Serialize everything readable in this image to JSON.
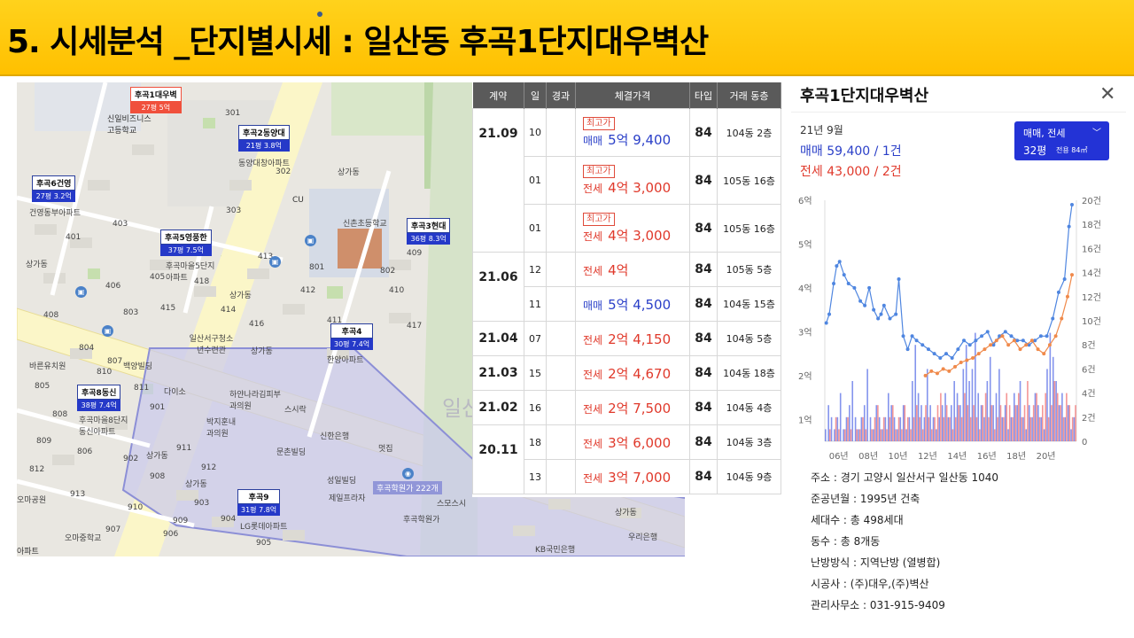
{
  "slide": {
    "title": "5. 시세분석 _단지별시세 : 일산동 후곡1단지대우벽산"
  },
  "map": {
    "watermark": "일산",
    "pins": [
      {
        "name": "후곡1대우벽",
        "price": "27평 5억",
        "color": "red"
      },
      {
        "name": "후곡2동양대",
        "price": "21평 3.8억",
        "color": "blue"
      },
      {
        "name": "후곡6건영",
        "price": "27평 3.2억",
        "color": "blue"
      },
      {
        "name": "후곡5영풍한",
        "price": "37평 7.5억",
        "color": "blue"
      },
      {
        "name": "후곡3현대",
        "price": "36평 8.3억",
        "color": "blue"
      },
      {
        "name": "후곡4",
        "price": "30평 7.4억",
        "color": "blue"
      },
      {
        "name": "후곡8동신",
        "price": "38평 7.4억",
        "color": "blue"
      },
      {
        "name": "후곡9",
        "price": "31평 7.8억",
        "color": "blue"
      }
    ],
    "labels": [
      "신일비즈니스고등학교",
      "동양대창아파트",
      "건영동부아파트",
      "상가동",
      "CU",
      "신촌초등학교",
      "후곡마을5단지아파트",
      "상가동",
      "일산서구청소년수련관",
      "상가동",
      "한양아파트",
      "바른유치원",
      "백양빌딩",
      "다이소",
      "하얀나라김피부과의원",
      "스시락",
      "후곡마을8단지동신아파트",
      "박지훈내과의원",
      "신한은행",
      "문촌빌딩",
      "멋집",
      "상가동",
      "상가동",
      "성일빌딩",
      "제일프라자",
      "후곡학원가",
      "스모스시",
      "LG롯데아파트",
      "오마중학교",
      "오마공원",
      "상가동",
      "우리은행",
      "KB국민은행",
      "상가동",
      "아파트"
    ],
    "busy_tag": "후곡학원가 222개",
    "numbers": [
      "401",
      "403",
      "405",
      "406",
      "408",
      "409",
      "410",
      "411",
      "412",
      "413",
      "414",
      "415",
      "416",
      "417",
      "418",
      "801",
      "802",
      "803",
      "804",
      "805",
      "806",
      "807",
      "808",
      "809",
      "810",
      "811",
      "812",
      "901",
      "902",
      "903",
      "904",
      "905",
      "906",
      "907",
      "908",
      "909",
      "910",
      "911",
      "912",
      "913",
      "301",
      "302",
      "303"
    ]
  },
  "trades": {
    "headers": [
      "계약",
      "일",
      "경과",
      "체결가격",
      "타입",
      "거래 동층"
    ],
    "groups": [
      {
        "ym": "21.09",
        "rows": [
          {
            "day": "10",
            "tag": "최고가",
            "kind": "매매",
            "amt": "5억 9,400",
            "type": "84",
            "dong": "104동  2층",
            "color": "sale"
          },
          {
            "day": "01",
            "tag": "최고가",
            "kind": "전세",
            "amt": "4억 3,000",
            "type": "84",
            "dong": "105동 16층",
            "color": "jeon"
          },
          {
            "day": "01",
            "tag": "최고가",
            "kind": "전세",
            "amt": "4억 3,000",
            "type": "84",
            "dong": "105동 16층",
            "color": "jeon"
          }
        ]
      },
      {
        "ym": "21.06",
        "rows": [
          {
            "day": "12",
            "tag": "",
            "kind": "전세",
            "amt": "4억",
            "type": "84",
            "dong": "105동  5층",
            "color": "jeon"
          },
          {
            "day": "11",
            "tag": "",
            "kind": "매매",
            "amt": "5억 4,500",
            "type": "84",
            "dong": "104동 15층",
            "color": "sale"
          }
        ]
      },
      {
        "ym": "21.04",
        "rows": [
          {
            "day": "07",
            "tag": "",
            "kind": "전세",
            "amt": "2억 4,150",
            "type": "84",
            "dong": "104동  5층",
            "color": "jeon"
          }
        ]
      },
      {
        "ym": "21.03",
        "rows": [
          {
            "day": "15",
            "tag": "",
            "kind": "전세",
            "amt": "2억 4,670",
            "type": "84",
            "dong": "104동 18층",
            "color": "jeon"
          }
        ]
      },
      {
        "ym": "21.02",
        "rows": [
          {
            "day": "16",
            "tag": "",
            "kind": "전세",
            "amt": "2억 7,500",
            "type": "84",
            "dong": "104동  4층",
            "color": "jeon"
          }
        ]
      },
      {
        "ym": "20.11",
        "rows": [
          {
            "day": "18",
            "tag": "",
            "kind": "전세",
            "amt": "3억 6,000",
            "type": "84",
            "dong": "104동  3층",
            "color": "jeon"
          },
          {
            "day": "13",
            "tag": "",
            "kind": "전세",
            "amt": "3억 7,000",
            "type": "84",
            "dong": "104동  9층",
            "color": "jeon"
          }
        ]
      }
    ]
  },
  "panel": {
    "title": "후곡1단지대우벽산",
    "month": "21년 9월",
    "sale_summary": "매매 59,400 / 1건",
    "jeonse_summary": "전세 43,000 / 2건",
    "selector_label": "매매, 전세",
    "selector_size": "32평",
    "selector_sub": "전용 84㎡",
    "colors": {
      "sale": "#2a3fc8",
      "jeonse": "#e0392b",
      "sale_line": "#4f86e0",
      "jeonse_line": "#f08a4b"
    }
  },
  "chart_data": {
    "type": "line",
    "x_ticks": [
      "06년",
      "08년",
      "10년",
      "12년",
      "14년",
      "16년",
      "18년",
      "20년"
    ],
    "y_left_ticks": [
      "1억",
      "2억",
      "3억",
      "4억",
      "5억",
      "6억"
    ],
    "y_left_range": [
      0.5,
      6
    ],
    "y_right_ticks": [
      "0",
      "2건",
      "4건",
      "6건",
      "8건",
      "10건",
      "12건",
      "14건",
      "16건",
      "18건",
      "20건"
    ],
    "y_right_range": [
      0,
      20
    ],
    "series": [
      {
        "name": "매매",
        "unit": "억",
        "x": [
          2005.1,
          2005.3,
          2005.6,
          2005.8,
          2006.0,
          2006.3,
          2006.6,
          2007.0,
          2007.4,
          2007.7,
          2008.0,
          2008.3,
          2008.6,
          2008.8,
          2009.0,
          2009.4,
          2009.8,
          2010.0,
          2010.3,
          2010.6,
          2010.9,
          2011.2,
          2011.6,
          2012.0,
          2012.4,
          2012.8,
          2013.2,
          2013.6,
          2014.0,
          2014.4,
          2014.8,
          2015.2,
          2015.6,
          2016.0,
          2016.4,
          2016.8,
          2017.2,
          2017.6,
          2018.0,
          2018.4,
          2018.8,
          2019.2,
          2019.6,
          2020.0,
          2020.4,
          2020.8,
          2021.2,
          2021.5,
          2021.7
        ],
        "values": [
          3.2,
          3.4,
          4.1,
          4.5,
          4.6,
          4.3,
          4.1,
          4.0,
          3.7,
          3.6,
          4.0,
          3.5,
          3.3,
          3.4,
          3.6,
          3.3,
          3.4,
          4.2,
          2.9,
          2.6,
          2.9,
          2.8,
          2.7,
          2.6,
          2.5,
          2.4,
          2.5,
          2.4,
          2.6,
          2.8,
          2.7,
          2.8,
          2.9,
          3.0,
          2.7,
          2.9,
          3.0,
          2.9,
          2.8,
          2.8,
          2.7,
          2.8,
          2.9,
          2.9,
          3.3,
          3.9,
          4.2,
          5.4,
          5.9
        ]
      },
      {
        "name": "전세",
        "unit": "억",
        "x": [
          2011.8,
          2012.2,
          2012.6,
          2013.0,
          2013.4,
          2013.8,
          2014.2,
          2014.6,
          2015.0,
          2015.4,
          2015.8,
          2016.2,
          2016.6,
          2017.0,
          2017.4,
          2017.8,
          2018.2,
          2018.6,
          2019.0,
          2019.4,
          2019.8,
          2020.2,
          2020.6,
          2021.0,
          2021.4,
          2021.7
        ],
        "values": [
          2.0,
          2.1,
          2.05,
          2.15,
          2.1,
          2.2,
          2.3,
          2.35,
          2.4,
          2.5,
          2.6,
          2.7,
          2.8,
          2.9,
          2.7,
          2.8,
          2.6,
          2.7,
          2.8,
          2.6,
          2.5,
          2.7,
          2.9,
          3.3,
          3.8,
          4.3
        ]
      },
      {
        "name": "매매 건수",
        "unit": "건",
        "values": [
          1,
          3,
          2,
          1,
          2,
          4,
          1,
          2,
          3,
          5,
          2,
          1,
          2,
          3,
          6,
          2,
          1,
          3,
          2,
          1,
          2,
          4,
          3,
          2,
          1,
          2,
          3,
          1,
          2,
          5,
          8,
          4,
          3,
          2,
          6,
          3,
          2,
          1,
          2,
          3,
          4,
          2,
          3,
          5,
          4,
          3,
          6,
          8,
          5,
          6,
          9,
          4,
          3,
          2,
          5,
          7,
          3,
          4,
          6,
          2,
          3,
          1,
          2,
          4,
          3,
          5,
          2,
          1,
          3,
          2,
          4,
          3,
          2,
          1,
          6,
          9,
          7,
          5,
          3,
          4,
          2,
          3,
          1,
          2
        ]
      },
      {
        "name": "전세 건수",
        "unit": "건",
        "values": [
          0,
          1,
          0,
          2,
          1,
          0,
          1,
          2,
          1,
          0,
          1,
          1,
          2,
          1,
          0,
          1,
          2,
          3,
          1,
          2,
          1,
          2,
          3,
          1,
          2,
          1,
          3,
          2,
          1,
          2,
          3,
          2,
          1,
          3,
          2,
          1,
          2,
          3,
          4,
          2,
          3,
          2,
          1,
          2,
          3,
          2,
          4,
          3,
          2,
          3,
          2,
          1,
          3,
          4,
          2,
          3,
          1,
          2,
          3,
          2,
          4,
          3,
          2,
          3,
          4,
          2,
          3,
          5,
          2,
          3,
          4,
          2,
          3,
          4,
          2,
          3,
          5,
          4,
          3,
          2,
          4,
          3,
          2,
          3
        ]
      }
    ]
  },
  "info": {
    "address": "주소 : 경기 고양시 일산서구 일산동 1040",
    "built": "준공년월 : 1995년 건축",
    "households": "세대수 : 총 498세대",
    "buildings": "동수 : 총 8개동",
    "heating": "난방방식 : 지역난방 (열병합)",
    "builder": "시공사 : (주)대우,(주)벽산",
    "office": "관리사무소 : 031-915-9409"
  }
}
